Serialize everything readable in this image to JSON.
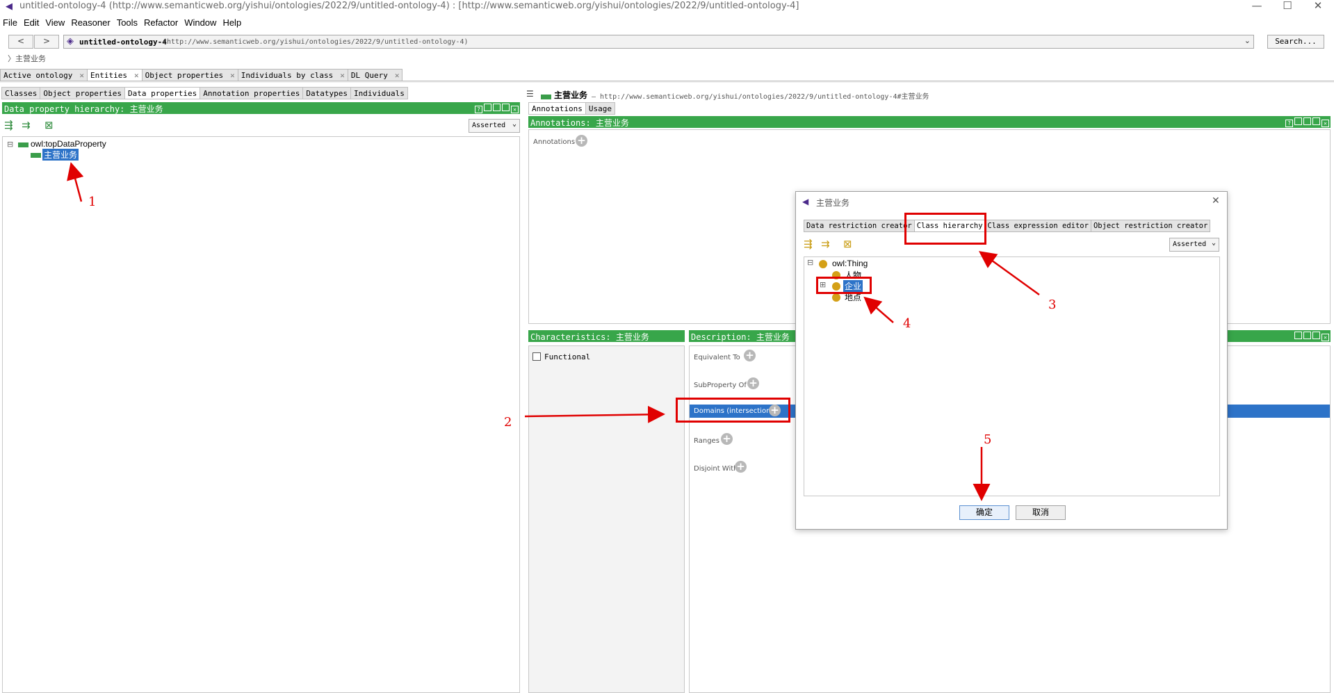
{
  "window": {
    "title": "untitled-ontology-4 (http://www.semanticweb.org/yishui/ontologies/2022/9/untitled-ontology-4)  : [http://www.semanticweb.org/yishui/ontologies/2022/9/untitled-ontology-4]",
    "minimize": "—",
    "maximize": "☐",
    "close": "✕"
  },
  "menu": [
    "File",
    "Edit",
    "View",
    "Reasoner",
    "Tools",
    "Refactor",
    "Window",
    "Help"
  ],
  "nav": {
    "back": "<",
    "forward": ">",
    "ontology_name": "untitled-ontology-4",
    "ontology_iri": "(http://www.semanticweb.org/yishui/ontologies/2022/9/untitled-ontology-4)",
    "dropdown": "⌄",
    "search": "Search...",
    "breadcrumb": "〉主营业务"
  },
  "main_tabs": [
    {
      "label": "Active ontology",
      "close": "✕"
    },
    {
      "label": "Entities",
      "close": "✕"
    },
    {
      "label": "Object properties",
      "close": "✕"
    },
    {
      "label": "Individuals by class",
      "close": "✕"
    },
    {
      "label": "DL Query",
      "close": "✕"
    }
  ],
  "left": {
    "sub_tabs": [
      "Classes",
      "Object properties",
      "Data properties",
      "Annotation properties",
      "Datatypes",
      "Individuals"
    ],
    "header": "Data property hierarchy: 主营业务",
    "mode": "Asserted",
    "tree": {
      "root": "owl:topDataProperty",
      "child": "主营业务",
      "collapse": "⊟"
    }
  },
  "right": {
    "entity_name": "主营业务",
    "entity_iri": "— http://www.semanticweb.org/yishui/ontologies/2022/9/untitled-ontology-4#主营业务",
    "tabs": [
      "Annotations",
      "Usage"
    ],
    "annotations_header": "Annotations: 主营业务",
    "annotations_label": "Annotations",
    "characteristics_header": "Characteristics: 主营业务",
    "functional": "Functional",
    "description_header": "Description: 主营业务",
    "sections": [
      "Equivalent To",
      "SubProperty Of",
      "Domains (intersection)",
      "Ranges",
      "Disjoint With"
    ]
  },
  "dialog": {
    "title": "主营业务",
    "close": "✕",
    "tabs": [
      "Data restriction creator",
      "Class hierarchy",
      "Class expression editor",
      "Object restriction creator"
    ],
    "mode": "Asserted",
    "tree": {
      "root": "owl:Thing",
      "children": [
        "人物",
        "企业",
        "地点"
      ],
      "collapse": "⊟",
      "expand": "⊞"
    },
    "ok": "确定",
    "cancel": "取消"
  },
  "annotations_overlay": [
    "1",
    "2",
    "3",
    "4",
    "5"
  ],
  "colors": {
    "green_header": "#38a64a",
    "selection": "#2d73c8",
    "annotation_red": "#e00000",
    "class_dot": "#d4a017"
  }
}
